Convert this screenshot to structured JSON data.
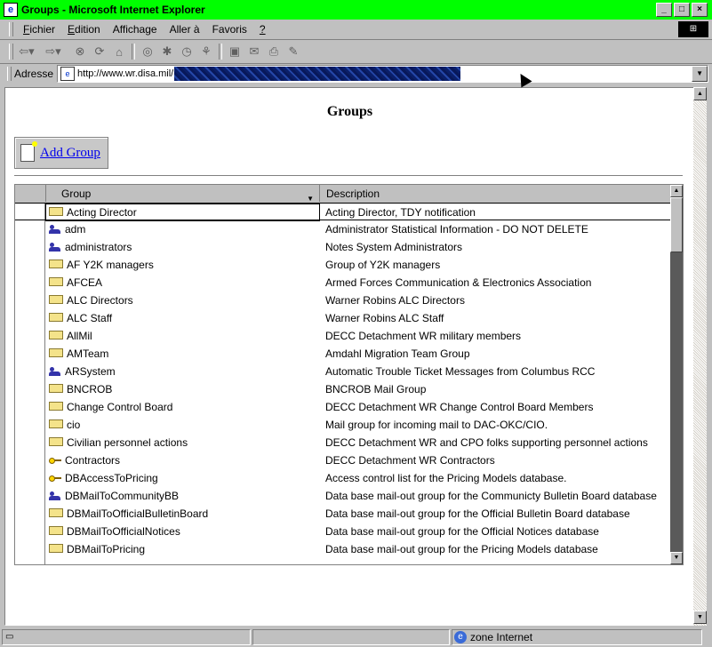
{
  "window": {
    "title": "Groups - Microsoft Internet Explorer",
    "buttons": [
      "_",
      "□",
      "×"
    ]
  },
  "menu": {
    "items": [
      {
        "underline": "F",
        "rest": "ichier"
      },
      {
        "underline": "E",
        "rest": "dition"
      },
      {
        "underline": "",
        "rest": "Affichage"
      },
      {
        "underline": "",
        "rest": "Aller à"
      },
      {
        "underline": "",
        "rest": "Favoris"
      },
      {
        "underline": "?",
        "rest": ""
      }
    ]
  },
  "toolbar": {
    "icons": [
      "back-icon",
      "forward-icon",
      "stop-icon",
      "refresh-icon",
      "home-icon",
      "search-icon",
      "favorites-icon",
      "history-icon",
      "channels-icon",
      "fullscreen-icon",
      "mail-icon",
      "print-icon",
      "edit-icon"
    ]
  },
  "address": {
    "label": "Adresse",
    "url": "http://www.wr.disa.mil/"
  },
  "page": {
    "title": "Groups",
    "add_group_label": "Add Group",
    "columns": {
      "group": "Group",
      "description": "Description"
    },
    "rows": [
      {
        "icon": "folder",
        "group": "Acting Director",
        "description": "Acting Director, TDY notification",
        "selected": true
      },
      {
        "icon": "people",
        "group": "adm",
        "description": "Administrator Statistical Information - DO NOT DELETE"
      },
      {
        "icon": "people",
        "group": "administrators",
        "description": "Notes System Administrators"
      },
      {
        "icon": "folder",
        "group": "AF Y2K managers",
        "description": "Group of Y2K managers"
      },
      {
        "icon": "folder",
        "group": "AFCEA",
        "description": "Armed Forces Communication & Electronics Association"
      },
      {
        "icon": "folder",
        "group": "ALC Directors",
        "description": "Warner Robins ALC Directors"
      },
      {
        "icon": "folder",
        "group": "ALC Staff",
        "description": "Warner Robins ALC Staff"
      },
      {
        "icon": "folder",
        "group": "AllMil",
        "description": "DECC Detachment WR military members"
      },
      {
        "icon": "folder",
        "group": "AMTeam",
        "description": "Amdahl Migration Team Group"
      },
      {
        "icon": "people",
        "group": "ARSystem",
        "description": "Automatic Trouble Ticket Messages from Columbus RCC"
      },
      {
        "icon": "folder",
        "group": "BNCROB",
        "description": "BNCROB Mail Group"
      },
      {
        "icon": "folder",
        "group": "Change Control Board",
        "description": "DECC Detachment WR Change Control Board Members"
      },
      {
        "icon": "folder",
        "group": "cio",
        "description": "Mail group for incoming mail to DAC-OKC/CIO."
      },
      {
        "icon": "folder",
        "group": "Civilian personnel actions",
        "description": "DECC Detachment WR and CPO folks supporting personnel actions"
      },
      {
        "icon": "key",
        "group": "Contractors",
        "description": "DECC Detachment WR Contractors"
      },
      {
        "icon": "key",
        "group": "DBAccessToPricing",
        "description": "Access control list for the Pricing Models database."
      },
      {
        "icon": "people",
        "group": "DBMailToCommunityBB",
        "description": "Data base mail-out group for the Communicty Bulletin Board database"
      },
      {
        "icon": "folder",
        "group": "DBMailToOfficialBulletinBoard",
        "description": "Data base mail-out group for the Official Bulletin Board database"
      },
      {
        "icon": "folder",
        "group": "DBMailToOfficialNotices",
        "description": "Data base mail-out group for the Official Notices database"
      },
      {
        "icon": "folder",
        "group": "DBMailToPricing",
        "description": "Data base mail-out group for the Pricing Models database"
      }
    ]
  },
  "status": {
    "zone": "zone Internet"
  }
}
